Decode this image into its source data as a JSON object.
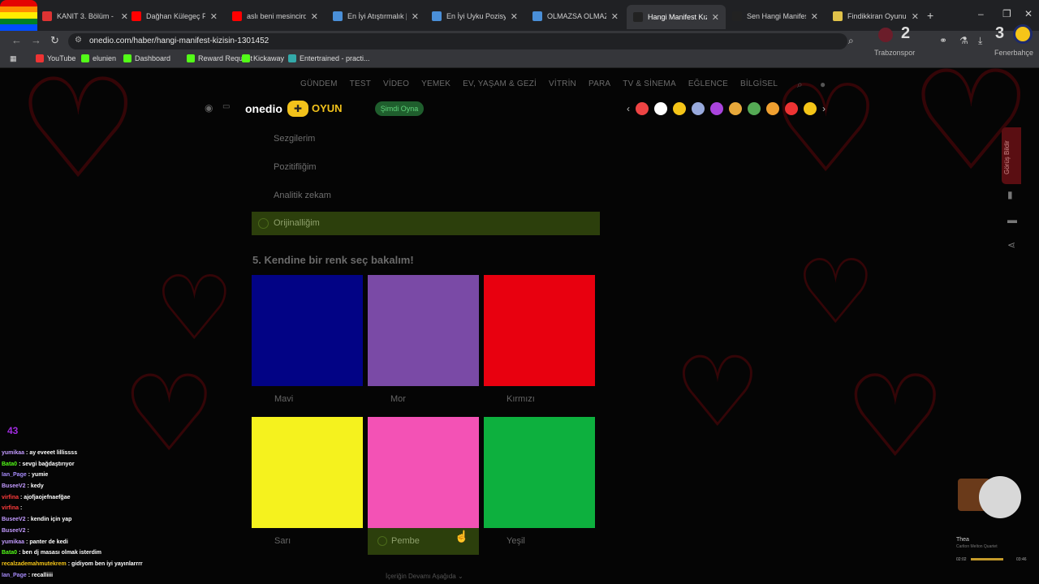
{
  "browser": {
    "tabs": [
      {
        "label": "KANIT 3. Bölüm - Full",
        "fav": "#d33"
      },
      {
        "label": "Dağhan Külegeç Fan",
        "fav": "#f00"
      },
      {
        "label": "aslı beni mesincirdan",
        "fav": "#f00"
      },
      {
        "label": "En İyi Atıştırmalık [25",
        "fav": "#4a8fd8"
      },
      {
        "label": "En İyi Uyku Pozisyonu",
        "fav": "#4a8fd8"
      },
      {
        "label": "OLMAZSA OLMAZ -",
        "fav": "#4a8fd8"
      },
      {
        "label": "Hangi Manifest Kızısı",
        "fav": "#222"
      },
      {
        "label": "Sen Hangi Manifest",
        "fav": "#222"
      },
      {
        "label": "Findikkiran Oyunu | E",
        "fav": "#e0c24a"
      }
    ],
    "active_tab_index": 6,
    "url": "onedio.com/haber/hangi-manifest-kizisin-1301452",
    "bookmarks": [
      "YouTube",
      "elunien",
      "Dashboard",
      "Reward Request",
      "Kickaway",
      "Entertrained - practi..."
    ],
    "bookmark_colors": [
      "#e33",
      "#53fc18",
      "#53fc18",
      "#53fc18",
      "#53fc18",
      "#3aa"
    ]
  },
  "site": {
    "nav": [
      "GÜNDEM",
      "TEST",
      "VİDEO",
      "YEMEK",
      "EV, YAŞAM & GEZİ",
      "VİTRİN",
      "PARA",
      "TV & SİNEMA",
      "EĞLENCE",
      "BİLGİSEL"
    ],
    "logo": "onedio",
    "oyun": "OYUN",
    "simdi_oyna": "Şimdi Oyna",
    "game_icon_colors": [
      "#e44",
      "#fff",
      "#f5c518",
      "#9ad",
      "#a4d",
      "#e7a83a",
      "#5a5",
      "#f0a030",
      "#e33",
      "#f5c518"
    ],
    "side_tab": "Görüş Bildir"
  },
  "quiz": {
    "prev_options": [
      "Sezgilerim",
      "Pozitifliğim",
      "Analitik zekam"
    ],
    "selected_prev": "Orijinalliğim",
    "question": "5. Kendine bir renk seç bakalım!",
    "colors": [
      {
        "name": "Mavi",
        "hex": "#020385"
      },
      {
        "name": "Mor",
        "hex": "#7a4aa6"
      },
      {
        "name": "Kırmızı",
        "hex": "#e8000f"
      },
      {
        "name": "Sarı",
        "hex": "#f5f21e"
      },
      {
        "name": "Pembe",
        "hex": "#f352b5"
      },
      {
        "name": "Yeşil",
        "hex": "#0db03e"
      }
    ],
    "selected_color": "Pembe",
    "continue": "İçeriğin Devamı Aşağıda"
  },
  "overlay": {
    "score_left": "2",
    "team_left": "Trabzonspor",
    "score_right": "3",
    "team_right": "Fenerbahçe",
    "viewers": "43",
    "chat": [
      {
        "user": "yumikaa",
        "color": "#c39bff",
        "msg": "ay eveeet lillissss"
      },
      {
        "user": "Bata0",
        "color": "#53fc18",
        "msg": "sevgi bağdaştırıyor"
      },
      {
        "user": "Ian_Page",
        "color": "#a78bfa",
        "msg": "yumie"
      },
      {
        "user": "BuseeV2",
        "color": "#c39bff",
        "msg": "kedy"
      },
      {
        "user": "virfina",
        "color": "#ff3b3b",
        "msg": "ajofjaojefnaefğae"
      },
      {
        "user": "virfina",
        "color": "#ff3b3b",
        "msg": ""
      },
      {
        "user": "BuseeV2",
        "color": "#c39bff",
        "msg": "kendin için yap"
      },
      {
        "user": "BuseeV2",
        "color": "#c39bff",
        "msg": ""
      },
      {
        "user": "yumikaa",
        "color": "#c39bff",
        "msg": "panter de kedi"
      },
      {
        "user": "Bata0",
        "color": "#53fc18",
        "msg": "ben dj masası olmak isterdim"
      },
      {
        "user": "recalzademahmutekrem",
        "color": "#f5c518",
        "msg": "gidiyom ben iyi yayınlarrrr"
      },
      {
        "user": "Ian_Page",
        "color": "#a78bfa",
        "msg": "recalliiii"
      }
    ],
    "music_title": "Thea",
    "music_artist": "Carlton Melton Quartet",
    "music_time_now": "02:02",
    "music_time_total": "03:46"
  }
}
